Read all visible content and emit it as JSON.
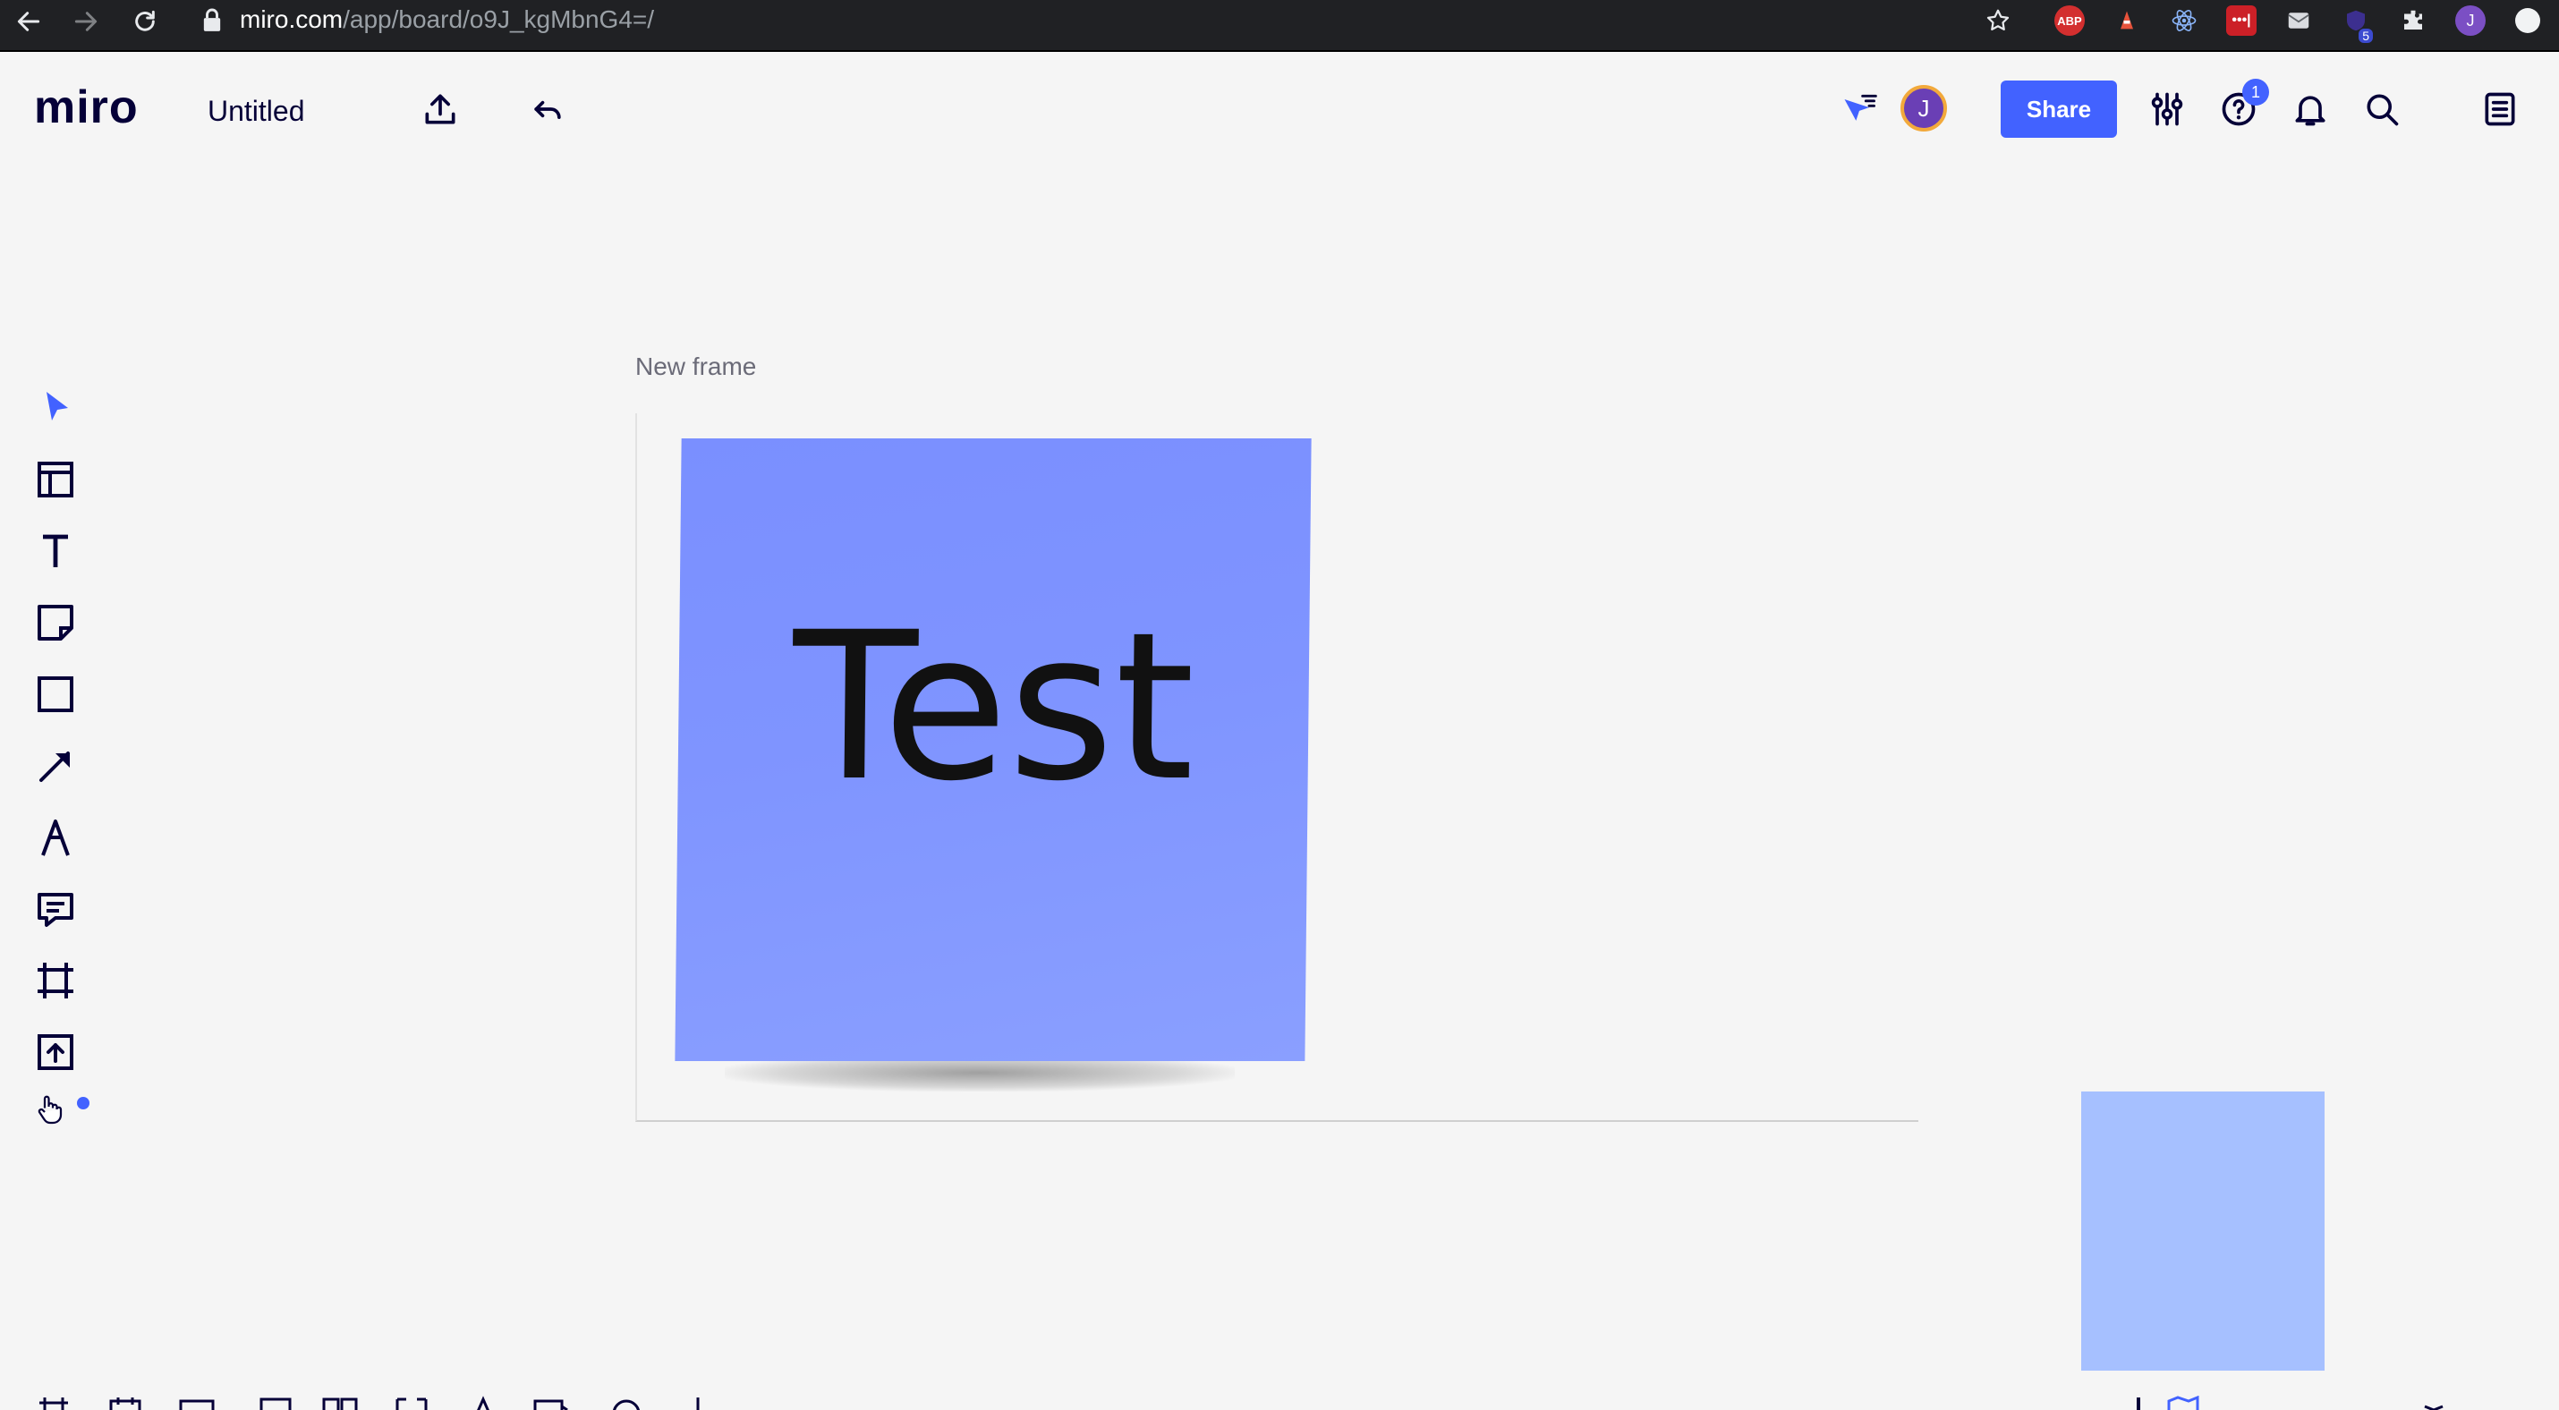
{
  "browser": {
    "url_host": "miro.com",
    "url_path": "/app/board/o9J_kgMbnG4=/",
    "extensions": [
      "star-icon",
      "adblock-icon",
      "ext-red-icon",
      "react-icon",
      "lastpass-icon",
      "ext-mail-icon",
      "ext-puzzle-badge-icon",
      "puzzle-icon",
      "profile-avatar-icon",
      "ext-white-icon"
    ],
    "extension_badge": "5",
    "profile_initial": "J"
  },
  "app": {
    "logo": "miro",
    "board_title": "Untitled",
    "share_label": "Share",
    "avatar_initial": "J",
    "help_badge": "1",
    "colors": {
      "accent": "#4262ff",
      "sticky": "#7a8fff",
      "mini_sticky": "#a6c0ff"
    }
  },
  "toolbar": {
    "tools": [
      {
        "name": "select-tool",
        "icon": "cursor-icon"
      },
      {
        "name": "templates-tool",
        "icon": "template-icon"
      },
      {
        "name": "text-tool",
        "icon": "text-icon"
      },
      {
        "name": "sticky-note-tool",
        "icon": "sticky-note-icon"
      },
      {
        "name": "shape-tool",
        "icon": "square-icon"
      },
      {
        "name": "connection-line-tool",
        "icon": "arrow-icon"
      },
      {
        "name": "pen-tool",
        "icon": "pen-icon"
      },
      {
        "name": "comment-tool",
        "icon": "comment-icon"
      },
      {
        "name": "frame-tool",
        "icon": "frame-icon"
      },
      {
        "name": "upload-tool",
        "icon": "upload-icon"
      },
      {
        "name": "more-apps-tool",
        "icon": "more-icon"
      }
    ]
  },
  "canvas": {
    "frame_label": "New frame",
    "sticky_text": "Test"
  }
}
